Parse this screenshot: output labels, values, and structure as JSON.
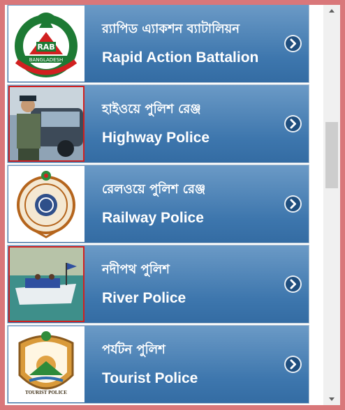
{
  "items": [
    {
      "bangla": "র‍্যাপিড এ্যাকশন ব্যাটালিয়ন",
      "english": "Rapid Action Battalion",
      "logo_text": "BANGLADESH",
      "logo_mark": "RAB"
    },
    {
      "bangla": "হাইওয়ে পুলিশ রেঞ্জ",
      "english": "Highway Police"
    },
    {
      "bangla": "রেলওয়ে পুলিশ রেঞ্জ",
      "english": "Railway Police"
    },
    {
      "bangla": "নদীপথ পুলিশ",
      "english": "River Police"
    },
    {
      "bangla": "পর্যটন পুলিশ",
      "english": "Tourist Police",
      "logo_text": "TOURIST POLICE"
    }
  ],
  "colors": {
    "item_top": "#6b9ac6",
    "item_bottom": "#346ca3",
    "chevron": "#1f4e7e",
    "frame_border": "#d9777a"
  }
}
